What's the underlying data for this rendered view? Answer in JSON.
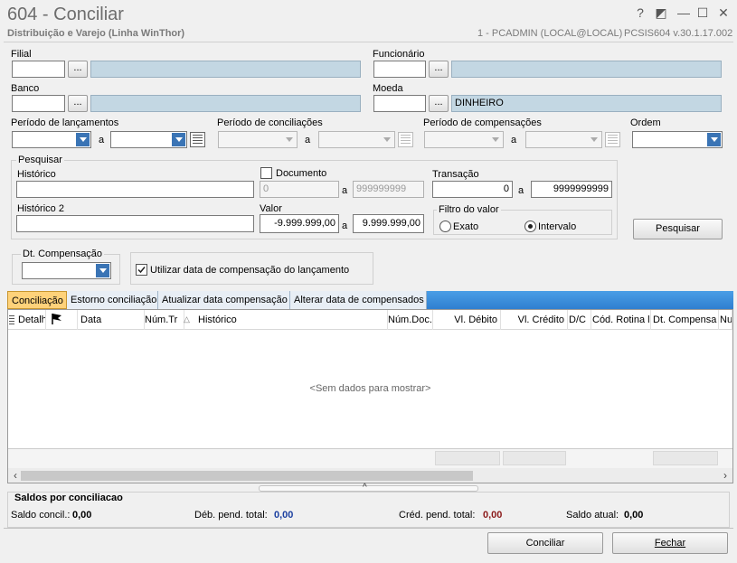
{
  "window": {
    "title": "604 - Conciliar",
    "subtitle": "Distribuição e Varejo (Linha WinThor)",
    "user": "1 - PCADMIN (LOCAL@LOCAL)",
    "version": "PCSIS604  v.30.1.17.002",
    "buttons": [
      "?",
      "◩",
      "—",
      "☐",
      "✕"
    ]
  },
  "form": {
    "filial_label": "Filial",
    "funcionario_label": "Funcionário",
    "banco_label": "Banco",
    "moeda_label": "Moeda",
    "moeda_desc": "DINHEIRO",
    "dots": "...",
    "periodo_lanc_label": "Período de lançamentos",
    "periodo_conc_label": "Período de conciliações",
    "periodo_comp_label": "Período de compensações",
    "ordem_label": "Ordem",
    "a": "a"
  },
  "pesquisar": {
    "group_label": "Pesquisar",
    "historico_label": "Histórico",
    "documento_label": "Documento",
    "doc_from": "0",
    "doc_to": "999999999",
    "transacao_label": "Transação",
    "trans_from": "0",
    "trans_to": "9999999999",
    "historico2_label": "Histórico 2",
    "valor_label": "Valor",
    "valor_from": "-9.999.999,00",
    "valor_to": "9.999.999,00",
    "filtro_label": "Filtro do valor",
    "exato_label": "Exato",
    "intervalo_label": "Intervalo",
    "pesquisar_button": "Pesquisar"
  },
  "dtcomp": {
    "label": "Dt. Compensação",
    "utilizar_label": "Utilizar data de compensação do lançamento"
  },
  "tabs": [
    "Conciliação",
    "Estorno conciliação",
    "Atualizar data compensação",
    "Alterar data de compensados"
  ],
  "grid": {
    "columns": [
      "Detalh",
      "",
      "Data",
      "Núm.Tr",
      "Histórico",
      "Núm.Doc.",
      "Vl. Débito",
      "Vl. Crédito",
      "D/C",
      "Cód. Rotina l",
      "Dt. Compensa",
      "Nu"
    ],
    "empty": "<Sem dados para mostrar>"
  },
  "saldos": {
    "title": "Saldos por conciliacao",
    "saldo_concil_label": "Saldo concil.:",
    "saldo_concil_value": "0,00",
    "deb_label": "Déb. pend. total:",
    "deb_value": "0,00",
    "cred_label": "Créd. pend. total:",
    "cred_value": "0,00",
    "atual_label": "Saldo atual:",
    "atual_value": "0,00"
  },
  "footer": {
    "conciliar_button": "Conciliar",
    "fechar_button": "Fechar"
  },
  "colors": {
    "deb_value": "#1a3fa0",
    "cred_value": "#8b1a1a",
    "tab_active": "#ffd27a",
    "tab_bar": "#2f7fd0"
  }
}
